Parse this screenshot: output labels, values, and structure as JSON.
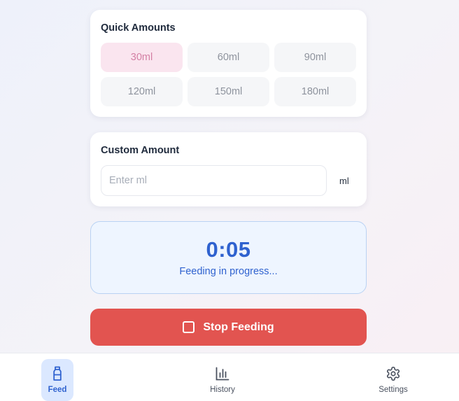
{
  "quick_amounts": {
    "title": "Quick Amounts",
    "options": [
      "30ml",
      "60ml",
      "90ml",
      "120ml",
      "150ml",
      "180ml"
    ],
    "selected": "30ml"
  },
  "custom_amount": {
    "title": "Custom Amount",
    "placeholder": "Enter ml",
    "value": "",
    "unit": "ml"
  },
  "timer": {
    "elapsed": "0:05",
    "status": "Feeding in progress..."
  },
  "stop_button": {
    "label": "Stop Feeding",
    "icon": "stop-square-icon"
  },
  "tabbar": {
    "active": "feed",
    "tabs": [
      {
        "id": "feed",
        "label": "Feed",
        "icon": "bottle-icon"
      },
      {
        "id": "history",
        "label": "History",
        "icon": "bar-chart-icon"
      },
      {
        "id": "settings",
        "label": "Settings",
        "icon": "gear-icon"
      }
    ]
  },
  "colors": {
    "accent_blue": "#2f62cf",
    "stop_red": "#e25450",
    "selected_pink": "#fae5ef",
    "selected_pink_text": "#d47fa4"
  }
}
